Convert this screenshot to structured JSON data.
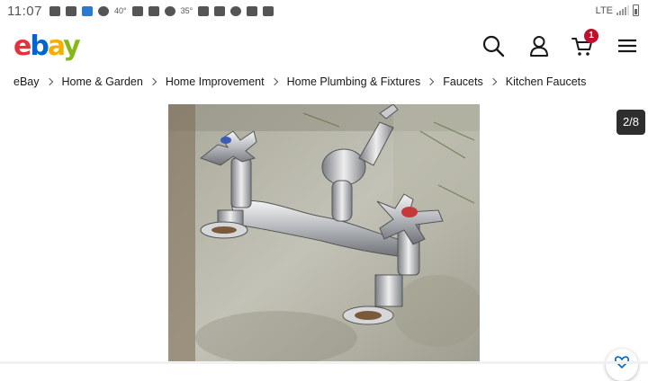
{
  "status_bar": {
    "time": "11:07",
    "temp_1": "40°",
    "temp_2": "35°",
    "network": "LTE"
  },
  "header": {
    "logo": {
      "e": "e",
      "b": "b",
      "a": "a",
      "y": "y"
    },
    "cart_count": "1"
  },
  "breadcrumb": [
    "eBay",
    "Home & Garden",
    "Home Improvement",
    "Home Plumbing & Fixtures",
    "Faucets",
    "Kitchen Faucets"
  ],
  "gallery": {
    "counter": "2/8"
  },
  "colors": {
    "ebay_red": "#e53238",
    "ebay_blue": "#0064d2",
    "ebay_yellow": "#f5af02",
    "ebay_green": "#86b817",
    "badge": "#c0102b"
  }
}
